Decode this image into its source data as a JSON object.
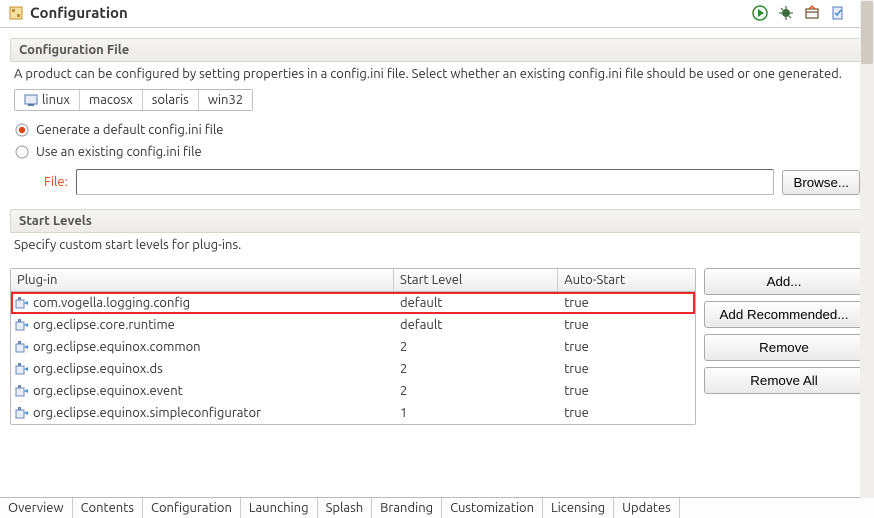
{
  "title": "Configuration",
  "configFile": {
    "sectionTitle": "Configuration File",
    "description": "A product can be configured by setting properties in a config.ini file.  Select whether an existing config.ini file should be used or one generated.",
    "platforms": [
      "linux",
      "macosx",
      "solaris",
      "win32"
    ],
    "activePlatformIndex": 0,
    "optGenerate": "Generate a default config.ini file",
    "optExisting": "Use an existing config.ini file",
    "selectedOption": 0,
    "fileLabel": "File:",
    "fileValue": "",
    "browseLabel": "Browse..."
  },
  "startLevels": {
    "sectionTitle": "Start Levels",
    "description": "Specify custom start levels for plug-ins.",
    "columns": {
      "plugin": "Plug-in",
      "startLevel": "Start Level",
      "autoStart": "Auto-Start"
    },
    "rows": [
      {
        "plugin": "com.vogella.logging.config",
        "startLevel": "default",
        "autoStart": "true",
        "highlight": true
      },
      {
        "plugin": "org.eclipse.core.runtime",
        "startLevel": "default",
        "autoStart": "true",
        "highlight": false
      },
      {
        "plugin": "org.eclipse.equinox.common",
        "startLevel": "2",
        "autoStart": "true",
        "highlight": false
      },
      {
        "plugin": "org.eclipse.equinox.ds",
        "startLevel": "2",
        "autoStart": "true",
        "highlight": false
      },
      {
        "plugin": "org.eclipse.equinox.event",
        "startLevel": "2",
        "autoStart": "true",
        "highlight": false
      },
      {
        "plugin": "org.eclipse.equinox.simpleconfigurator",
        "startLevel": "1",
        "autoStart": "true",
        "highlight": false
      }
    ],
    "buttons": {
      "add": "Add...",
      "addRecommended": "Add Recommended...",
      "remove": "Remove",
      "removeAll": "Remove All"
    }
  },
  "bottomTabs": [
    "Overview",
    "Contents",
    "Configuration",
    "Launching",
    "Splash",
    "Branding",
    "Customization",
    "Licensing",
    "Updates"
  ],
  "activeBottomTabIndex": 2
}
